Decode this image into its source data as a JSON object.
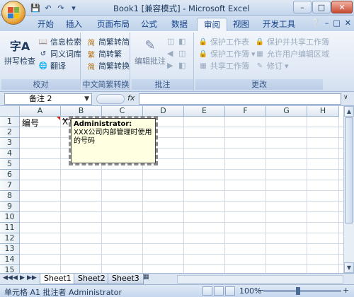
{
  "title": "Book1  [兼容模式] - Microsoft Excel",
  "tabs": [
    "开始",
    "插入",
    "页面布局",
    "公式",
    "数据",
    "审阅",
    "视图",
    "开发工具"
  ],
  "active_tab": "审阅",
  "ribbon": {
    "proofing": {
      "label": "校对",
      "spell_check": "拼写检查",
      "research": "信息检索",
      "thesaurus": "同义词库",
      "translate": "翻译"
    },
    "chinese": {
      "label": "中文简繁转换",
      "to_simplified": "简繁转简",
      "to_traditional": "简转繁",
      "convert": "简繁转换"
    },
    "comments": {
      "label": "批注",
      "edit_comment": "编辑批注"
    },
    "changes": {
      "label": "更改",
      "protect_sheet": "保护工作表",
      "protect_workbook": "保护工作簿",
      "share_workbook": "共享工作簿",
      "protect_share": "保护并共享工作簿",
      "allow_edit_ranges": "允许用户编辑区域",
      "track_changes": "修订"
    }
  },
  "formula_bar": {
    "name_box": "备注 2",
    "fx": "fx",
    "value": ""
  },
  "columns": [
    "A",
    "B",
    "C",
    "D",
    "E",
    "F",
    "G",
    "H"
  ],
  "rows": [
    "1",
    "2",
    "3",
    "4",
    "5",
    "6",
    "7",
    "8",
    "9",
    "10",
    "11",
    "12",
    "13",
    "14",
    "15"
  ],
  "cells": {
    "A1": "编号",
    "B1": "XX"
  },
  "comment": {
    "author": "Administrator:",
    "text": "XXX公司内部管理时使用的号码"
  },
  "sheets": [
    "Sheet1",
    "Sheet2",
    "Sheet3"
  ],
  "active_sheet": "Sheet1",
  "status": "单元格 A1 批注者 Administrator",
  "zoom": "100%",
  "colors": {
    "ribbon_bg": "#dfe8f4",
    "comment_bg": "#ffffe1",
    "comment_indicator": "#dd2211"
  }
}
